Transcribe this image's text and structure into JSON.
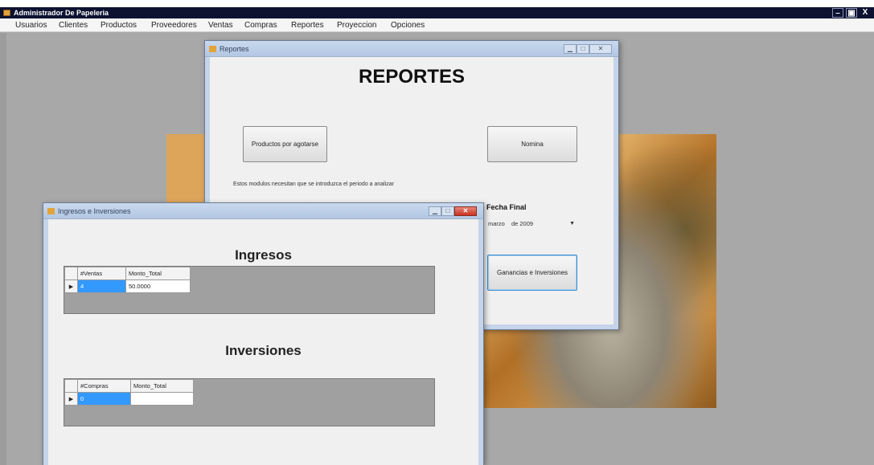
{
  "app": {
    "title": "Administrador De Papeleria",
    "window_buttons": [
      "–",
      "▣",
      "X"
    ]
  },
  "menu": [
    "Usuarios",
    "Clientes",
    "Productos",
    "Proveedores",
    "Ventas",
    "Compras",
    "Reportes",
    "Proyeccion",
    "Opciones"
  ],
  "reportes": {
    "title": "Reportes",
    "heading": "REPORTES",
    "btn_productos": "Productos por agotarse",
    "btn_nomina": "Nomina",
    "note": "Estos modulos necesitan que se introduzca el periodo a analizar",
    "fecha_final_label": "Fecha Final",
    "date_month": "marzo",
    "date_year": "de 2009",
    "btn_ganancias": "Ganancias e Inversiones"
  },
  "ingresos": {
    "title": "Ingresos e Inversiones",
    "ingresos_heading": "Ingresos",
    "inversiones_heading": "Inversiones",
    "ingresos_table": {
      "columns": [
        "#Ventas",
        "Monto_Total"
      ],
      "rows": [
        [
          "4",
          "50.0000"
        ]
      ]
    },
    "inversiones_table": {
      "columns": [
        "#Compras",
        "Monto_Total"
      ],
      "rows": [
        [
          "0",
          ""
        ]
      ]
    }
  }
}
